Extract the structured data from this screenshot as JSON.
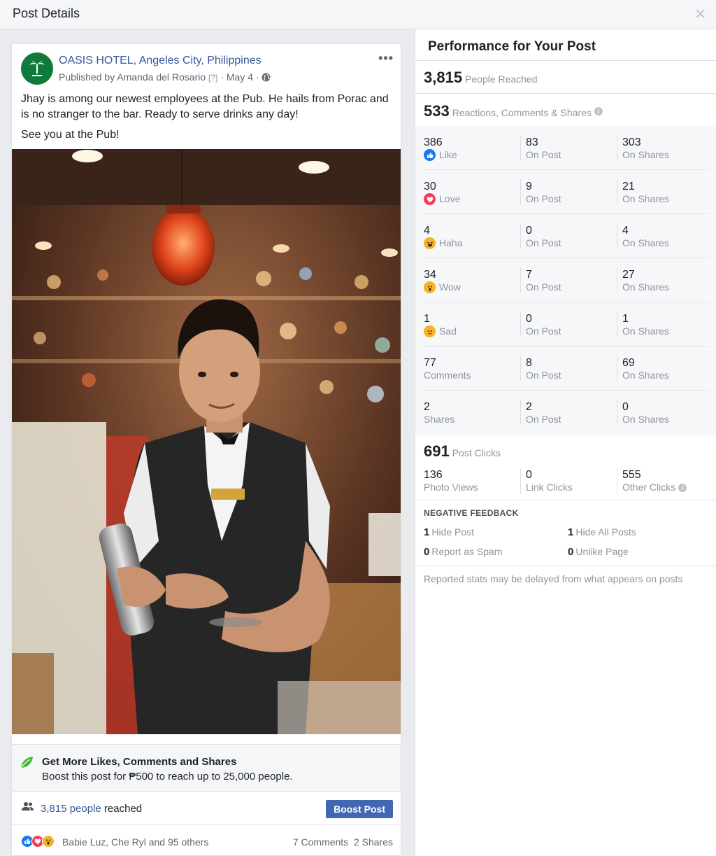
{
  "header": {
    "title": "Post Details"
  },
  "post": {
    "page_name": "OASIS HOTEL, Angeles City, Philippines",
    "published_by": "Published by Amanda del Rosario",
    "help_mark": "[?]",
    "date": "· May 4 ·",
    "text_1": "Jhay is among our newest employees at the Pub. He hails from Porac and is no stranger to the bar. Ready to serve drinks any day!",
    "text_2": "See you at the Pub!",
    "boost_heading": "Get More Likes, Comments and Shares",
    "boost_sub": "Boost this post for ₱500 to reach up to 25,000 people.",
    "reach_link": "3,815 people",
    "reach_suffix": " reached",
    "boost_button": "Boost Post",
    "reactors": "Babie Luz, Che Ryl and 95 others",
    "comments_count": "7 Comments",
    "shares_count": "2 Shares"
  },
  "panel": {
    "title": "Performance for Your Post",
    "reached_value": "3,815",
    "reached_label": "People Reached",
    "engage_value": "533",
    "engage_label": "Reactions, Comments & Shares",
    "rows": [
      {
        "total": "386",
        "label": "Like",
        "icon": "like-icon",
        "on_post": "83",
        "on_shares": "303"
      },
      {
        "total": "30",
        "label": "Love",
        "icon": "love-icon",
        "on_post": "9",
        "on_shares": "21"
      },
      {
        "total": "4",
        "label": "Haha",
        "icon": "haha-icon",
        "on_post": "0",
        "on_shares": "4"
      },
      {
        "total": "34",
        "label": "Wow",
        "icon": "wow-icon",
        "on_post": "7",
        "on_shares": "27"
      },
      {
        "total": "1",
        "label": "Sad",
        "icon": "sad-icon",
        "on_post": "0",
        "on_shares": "1"
      },
      {
        "total": "77",
        "label": "Comments",
        "icon": "",
        "on_post": "8",
        "on_shares": "69"
      },
      {
        "total": "2",
        "label": "Shares",
        "icon": "",
        "on_post": "2",
        "on_shares": "0"
      }
    ],
    "on_post_label": "On Post",
    "on_shares_label": "On Shares",
    "clicks_value": "691",
    "clicks_label": "Post Clicks",
    "photo_views_value": "136",
    "photo_views_label": "Photo Views",
    "link_clicks_value": "0",
    "link_clicks_label": "Link Clicks",
    "other_clicks_value": "555",
    "other_clicks_label": "Other Clicks",
    "negative_title": "NEGATIVE FEEDBACK",
    "hide_post_value": "1",
    "hide_post_label": "Hide Post",
    "hide_all_value": "1",
    "hide_all_label": "Hide All Posts",
    "spam_value": "0",
    "spam_label": "Report as Spam",
    "unlike_value": "0",
    "unlike_label": "Unlike Page",
    "footnote": "Reported stats may be delayed from what appears on posts"
  },
  "colors": {
    "link": "#365899",
    "button": "#4267b2",
    "like": "#1877f2",
    "love": "#f33e58",
    "emoji": "#f7b125"
  }
}
